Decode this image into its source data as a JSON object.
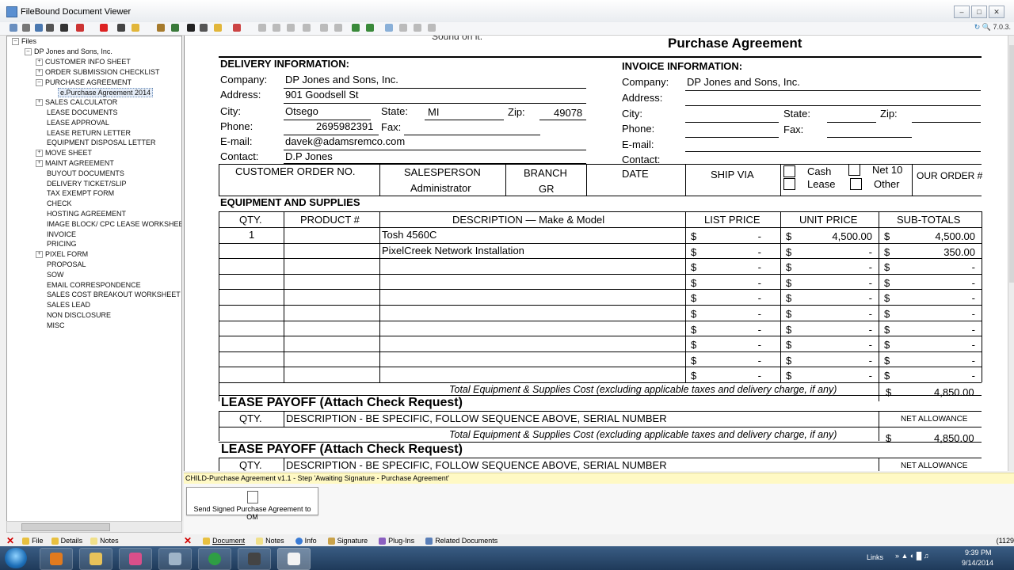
{
  "window": {
    "title": "FileBound Document Viewer",
    "version": "7.0.3."
  },
  "tree": {
    "root": "Files",
    "client": "DP Jones and Sons, Inc.",
    "items": [
      {
        "label": "CUSTOMER INFO SHEET",
        "exp": true
      },
      {
        "label": "ORDER SUBMISSION CHECKLIST",
        "exp": true
      },
      {
        "label": "PURCHASE AGREEMENT",
        "exp": true,
        "open": true
      },
      {
        "label": "e.Purchase Agreement 2014",
        "child": true,
        "selected": true
      },
      {
        "label": "SALES CALCULATOR",
        "exp": true
      },
      {
        "label": "LEASE DOCUMENTS"
      },
      {
        "label": "LEASE APPROVAL"
      },
      {
        "label": "LEASE RETURN LETTER"
      },
      {
        "label": "EQUIPMENT DISPOSAL LETTER"
      },
      {
        "label": "MOVE SHEET",
        "exp": true
      },
      {
        "label": "MAINT AGREEMENT",
        "exp": true
      },
      {
        "label": "BUYOUT DOCUMENTS"
      },
      {
        "label": "DELIVERY TICKET/SLIP"
      },
      {
        "label": "TAX EXEMPT FORM"
      },
      {
        "label": "CHECK"
      },
      {
        "label": "HOSTING AGREEMENT"
      },
      {
        "label": "IMAGE BLOCK/ CPC LEASE WORKSHEET"
      },
      {
        "label": "INVOICE"
      },
      {
        "label": "PRICING"
      },
      {
        "label": "PIXEL FORM",
        "exp": true
      },
      {
        "label": "PROPOSAL"
      },
      {
        "label": "SOW"
      },
      {
        "label": "EMAIL CORRESPONDENCE"
      },
      {
        "label": "SALES COST BREAKOUT WORKSHEET"
      },
      {
        "label": "SALES LEAD"
      },
      {
        "label": "NON DISCLOSURE"
      },
      {
        "label": "MISC"
      }
    ]
  },
  "doc": {
    "top_fragment": "Sound on it.",
    "title": "Purchase Agreement",
    "delivery": {
      "heading": "DELIVERY INFORMATION:",
      "company_label": "Company:",
      "company": "DP Jones and Sons, Inc.",
      "address_label": "Address:",
      "address": "901 Goodsell St",
      "city_label": "City:",
      "city": "Otsego",
      "state_label": "State:",
      "state": "MI",
      "zip_label": "Zip:",
      "zip": "49078",
      "phone_label": "Phone:",
      "phone": "2695982391",
      "fax_label": "Fax:",
      "email_label": "E-mail:",
      "email": "davek@adamsremco.com",
      "contact_label": "Contact:",
      "contact": "D.P Jones"
    },
    "invoice": {
      "heading": "INVOICE INFORMATION:",
      "company_label": "Company:",
      "company": "DP Jones and Sons, Inc.",
      "address_label": "Address:",
      "city_label": "City:",
      "state_label": "State:",
      "zip_label": "Zip:",
      "phone_label": "Phone:",
      "fax_label": "Fax:",
      "email_label": "E-mail:",
      "contact_label": "Contact:"
    },
    "order_row": {
      "customer_order": "CUSTOMER ORDER NO.",
      "salesperson": "SALESPERSON",
      "salesperson_value": "Administrator",
      "branch": "BRANCH",
      "branch_value": "GR",
      "date": "DATE",
      "ship_via": "SHIP VIA",
      "cash": "Cash",
      "net10": "Net 10",
      "lease": "Lease",
      "other": "Other",
      "our_order": "OUR ORDER #"
    },
    "equipment": {
      "heading": "EQUIPMENT AND SUPPLIES",
      "qty": "QTY.",
      "product": "PRODUCT #",
      "description": "DESCRIPTION — Make & Model",
      "list_price": "LIST PRICE",
      "unit_price": "UNIT PRICE",
      "subtotals": "SUB-TOTALS",
      "rows": [
        {
          "qty": "1",
          "desc": "Tosh 4560C",
          "list": "-",
          "unit": "4,500.00",
          "sub": "4,500.00"
        },
        {
          "qty": "",
          "desc": "PixelCreek Network Installation",
          "list": "-",
          "unit": "-",
          "sub": "350.00"
        },
        {
          "qty": "",
          "desc": "",
          "list": "-",
          "unit": "-",
          "sub": "-"
        },
        {
          "qty": "",
          "desc": "",
          "list": "-",
          "unit": "-",
          "sub": "-"
        },
        {
          "qty": "",
          "desc": "",
          "list": "-",
          "unit": "-",
          "sub": "-"
        },
        {
          "qty": "",
          "desc": "",
          "list": "-",
          "unit": "-",
          "sub": "-"
        },
        {
          "qty": "",
          "desc": "",
          "list": "-",
          "unit": "-",
          "sub": "-"
        },
        {
          "qty": "",
          "desc": "",
          "list": "-",
          "unit": "-",
          "sub": "-"
        },
        {
          "qty": "",
          "desc": "",
          "list": "-",
          "unit": "-",
          "sub": "-"
        },
        {
          "qty": "",
          "desc": "",
          "list": "-",
          "unit": "-",
          "sub": "-"
        }
      ],
      "currency": "$",
      "total_label": "Total Equipment & Supplies Cost (excluding applicable taxes and delivery charge, if any)",
      "total": "4,850.00"
    },
    "lease_payoff": {
      "heading": "LEASE PAYOFF (Attach Check Request)",
      "qty": "QTY.",
      "description": "DESCRIPTION - BE SPECIFIC, FOLLOW SEQUENCE ABOVE, SERIAL NUMBER",
      "net_allowance": "NET ALLOWANCE",
      "total_label": "Total Equipment & Supplies Cost (excluding applicable taxes and delivery charge, if any)",
      "total": "4,850.00"
    }
  },
  "workflow": {
    "status": "CHILD-Purchase Agreement v1.1 - Step 'Awaiting Signature - Purchase Agreement'",
    "button": "Send Signed Purchase Agreement to OM"
  },
  "left_tabs": {
    "file": "File",
    "details": "Details",
    "notes": "Notes"
  },
  "bottom_tabs": [
    "Document",
    "Notes",
    "Info",
    "Signature",
    "Plug-Ins",
    "Related Documents"
  ],
  "bottom_right": "(1129",
  "tray": {
    "links": "Links",
    "time": "9:39 PM",
    "date": "9/14/2014"
  }
}
